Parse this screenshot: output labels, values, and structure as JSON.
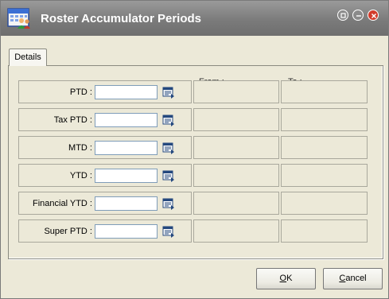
{
  "window": {
    "title": "Roster Accumulator Periods",
    "icon": "calendar-people-icon",
    "controls": [
      "restore-icon",
      "minimize-icon",
      "close-icon"
    ]
  },
  "tabs": [
    {
      "label": "Details",
      "active": true
    }
  ],
  "columns": {
    "from_label": "From :",
    "to_label": "To :"
  },
  "rows": [
    {
      "label": "PTD :",
      "value": ""
    },
    {
      "label": "Tax PTD :",
      "value": ""
    },
    {
      "label": "MTD :",
      "value": ""
    },
    {
      "label": "YTD :",
      "value": ""
    },
    {
      "label": "Financial YTD :",
      "value": ""
    },
    {
      "label": "Super PTD :",
      "value": ""
    }
  ],
  "buttons": {
    "ok": {
      "accel": "O",
      "rest": "K"
    },
    "cancel": {
      "accel": "C",
      "rest": "ancel"
    }
  },
  "colors": {
    "titlebar": "#7b7b7b",
    "close": "#d23b2b",
    "face": "#ece9d8"
  }
}
